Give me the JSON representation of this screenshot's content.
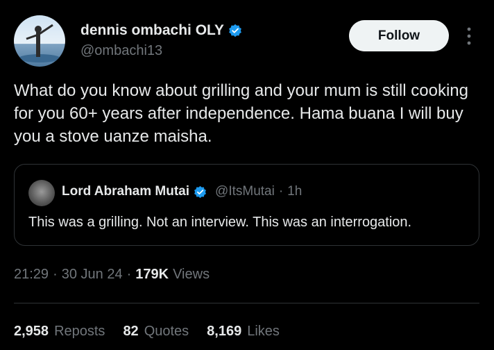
{
  "author": {
    "name": "dennis ombachi OLY",
    "handle": "@ombachi13"
  },
  "follow_label": "Follow",
  "tweet_text": "What do you know about grilling and your mum is still cooking for you 60+ years after independence. Hama buana I  will buy you a stove uanze maisha.",
  "quoted": {
    "name": "Lord Abraham Mutai",
    "handle": "@ItsMutai",
    "separator": "·",
    "time": "1h",
    "text": "This was a grilling. Not an interview. This was an interrogation."
  },
  "meta": {
    "time": "21:29",
    "sep1": "·",
    "date": "30 Jun 24",
    "sep2": "·",
    "views_count": "179K",
    "views_label": "Views"
  },
  "stats": [
    {
      "count": "2,958",
      "label": "Reposts"
    },
    {
      "count": "82",
      "label": "Quotes"
    },
    {
      "count": "8,169",
      "label": "Likes"
    }
  ],
  "colors": {
    "background": "#000000",
    "text": "#e7e9ea",
    "muted": "#71767b",
    "verified": "#1d9bf0",
    "border": "#2f3336"
  },
  "icons": [
    "verified-badge-icon",
    "more-options-icon"
  ]
}
